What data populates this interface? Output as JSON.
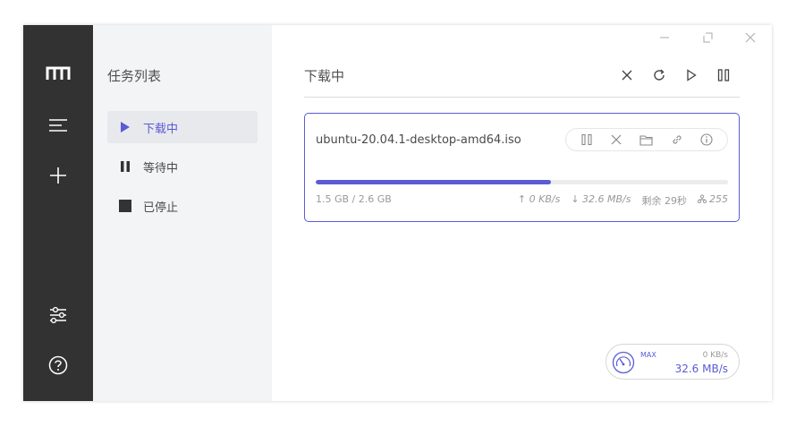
{
  "colors": {
    "accent": "#5b5bd6",
    "rail": "#323232",
    "sidebar": "#f3f4f6"
  },
  "rail": {
    "items": [
      {
        "icon": "logo-icon"
      },
      {
        "icon": "task-list-icon"
      },
      {
        "icon": "add-task-icon"
      },
      {
        "icon": "preferences-icon"
      },
      {
        "icon": "help-icon"
      }
    ]
  },
  "sidebar": {
    "title": "任务列表",
    "items": [
      {
        "label": "下载中",
        "icon": "play-icon",
        "active": true
      },
      {
        "label": "等待中",
        "icon": "pause-icon",
        "active": false
      },
      {
        "label": "已停止",
        "icon": "stop-icon",
        "active": false
      }
    ]
  },
  "main": {
    "title": "下载中",
    "toolbar": [
      {
        "icon": "delete-icon"
      },
      {
        "icon": "refresh-icon"
      },
      {
        "icon": "resume-all-icon"
      },
      {
        "icon": "pause-all-icon"
      }
    ]
  },
  "task": {
    "name": "ubuntu-20.04.1-desktop-amd64.iso",
    "progress": 0.57,
    "size": "1.5 GB / 2.6 GB",
    "upload_speed": "↑ 0 KB/s",
    "download_speed": "↓ 32.6 MB/s",
    "remaining": "剩余 29秒",
    "connections": "255"
  },
  "speedometer": {
    "label": "MAX",
    "upload": "0 KB/s",
    "download": "32.6 MB/s"
  }
}
